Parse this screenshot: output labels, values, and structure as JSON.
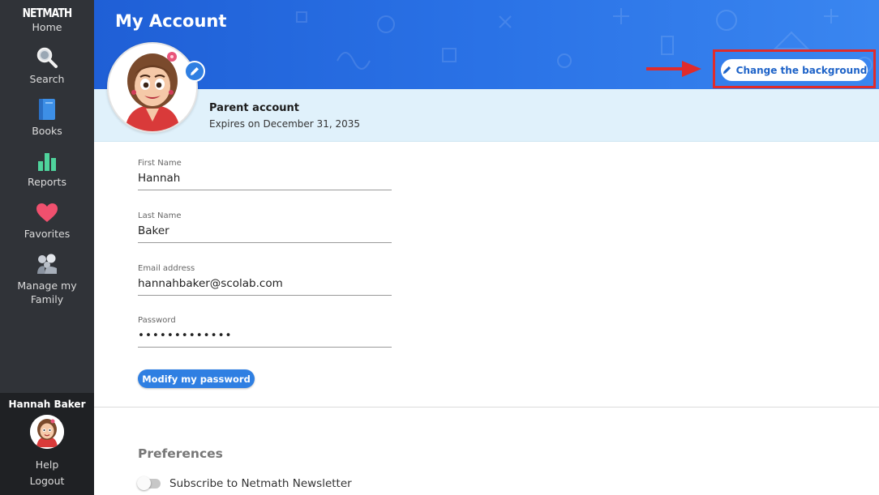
{
  "sidebar": {
    "logo": "NETMATH",
    "home_label": "Home",
    "items": [
      {
        "label": "Search",
        "icon": "magnifier-icon"
      },
      {
        "label": "Books",
        "icon": "book-icon"
      },
      {
        "label": "Reports",
        "icon": "bar-chart-icon"
      },
      {
        "label": "Favorites",
        "icon": "heart-icon"
      },
      {
        "label": "Manage my Family",
        "icon": "family-icon"
      }
    ],
    "user_name": "Hannah Baker",
    "help_label": "Help",
    "logout_label": "Logout"
  },
  "header": {
    "title": "My Account",
    "change_background_label": "Change the background",
    "account_type": "Parent account",
    "expires": "Expires on December 31, 2035"
  },
  "form": {
    "first_name": {
      "label": "First Name",
      "value": "Hannah"
    },
    "last_name": {
      "label": "Last Name",
      "value": "Baker"
    },
    "email": {
      "label": "Email address",
      "value": "hannahbaker@scolab.com"
    },
    "password": {
      "label": "Password",
      "value": "•••••••••••••"
    },
    "modify_password_label": "Modify my password"
  },
  "preferences": {
    "title": "Preferences",
    "newsletter_label": "Subscribe to Netmath Newsletter",
    "newsletter_on": false
  },
  "colors": {
    "sidebar": "#303338",
    "accent": "#2f7fe2",
    "annotation": "#e02b2b"
  }
}
